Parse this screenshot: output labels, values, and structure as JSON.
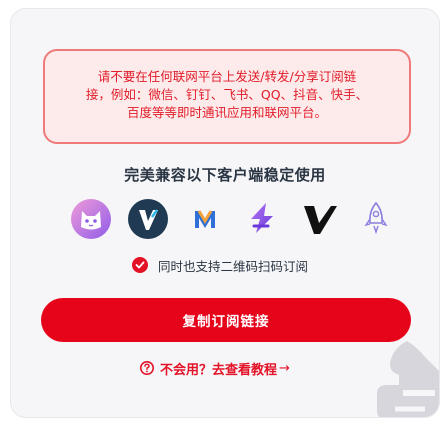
{
  "warning": {
    "line1": "请不要在任何联网平台上发送/转发/分享订阅链",
    "line2": "接，例如：微信、钉钉、飞书、QQ、抖音、快手、",
    "line3": "百度等等即时通讯应用和联网平台。"
  },
  "compat_title": "完美兼容以下客户端稳定使用",
  "apps": [
    "cat-app-icon",
    "v2ray-v-icon",
    "mailbox-m-icon",
    "stash-bolt-icon",
    "vpn-v-icon",
    "rocket-icon"
  ],
  "qr_support_label": "同时也支持二维码扫码订阅",
  "copy_button_label": "复制订阅链接",
  "help": {
    "text": "不会用？去查看教程",
    "arrow": "→"
  },
  "colors": {
    "accent": "#e6041b",
    "warning_bg": "#fdeaea",
    "warning_border": "#ee7a7a",
    "text_dark": "#2b3644"
  }
}
